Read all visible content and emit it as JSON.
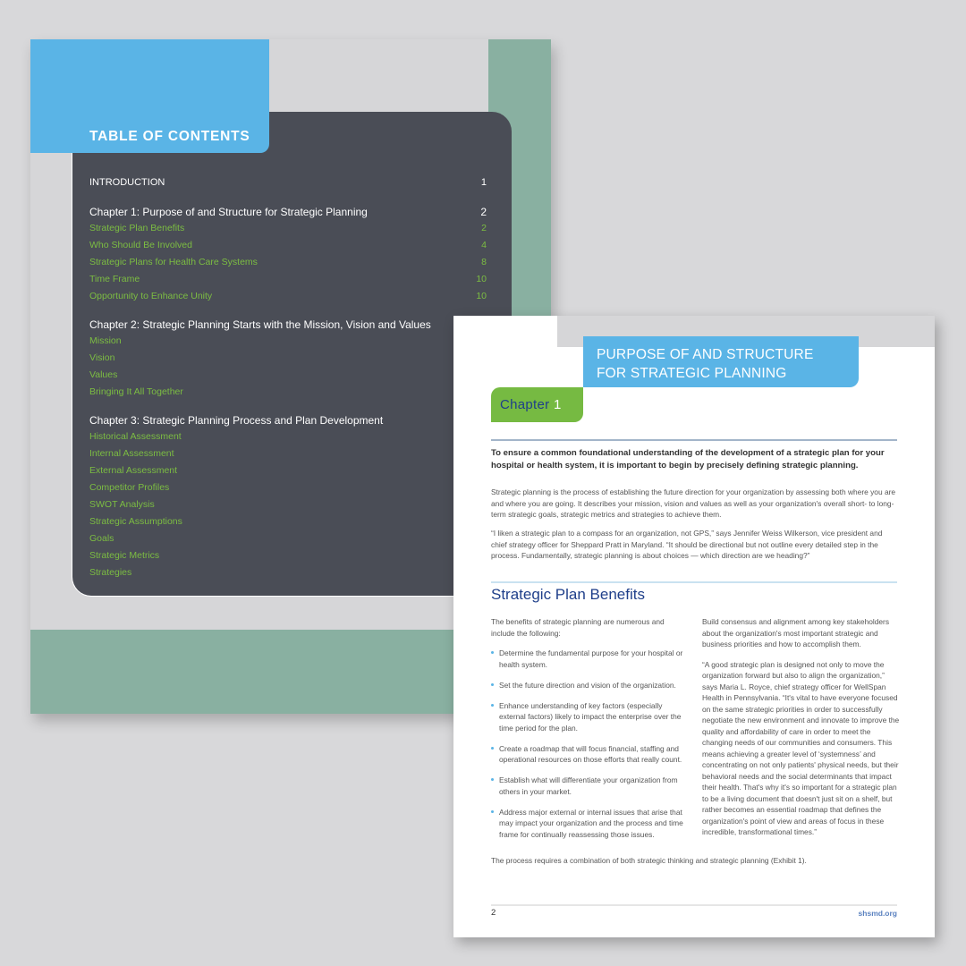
{
  "toc_page": {
    "title": "TABLE OF CONTENTS",
    "introduction": {
      "label": "INTRODUCTION",
      "page": "1"
    },
    "chapters": [
      {
        "label": "Chapter 1: Purpose of and Structure for Strategic Planning",
        "page": "2",
        "sections": [
          {
            "label": "Strategic Plan Benefits",
            "page": "2"
          },
          {
            "label": "Who Should Be Involved",
            "page": "4"
          },
          {
            "label": "Strategic Plans for Health Care Systems",
            "page": "8"
          },
          {
            "label": "Time Frame",
            "page": "10"
          },
          {
            "label": "Opportunity to Enhance Unity",
            "page": "10"
          }
        ]
      },
      {
        "label": "Chapter 2: Strategic Planning Starts with the Mission, Vision and Values",
        "page": "",
        "sections": [
          {
            "label": "Mission",
            "page": ""
          },
          {
            "label": "Vision",
            "page": ""
          },
          {
            "label": "Values",
            "page": ""
          },
          {
            "label": "Bringing It All Together",
            "page": ""
          }
        ]
      },
      {
        "label": "Chapter 3: Strategic Planning Process and Plan Development",
        "page": "",
        "sections": [
          {
            "label": "Historical Assessment",
            "page": ""
          },
          {
            "label": "Internal Assessment",
            "page": ""
          },
          {
            "label": "External Assessment",
            "page": ""
          },
          {
            "label": "Competitor Profiles",
            "page": ""
          },
          {
            "label": "SWOT Analysis",
            "page": ""
          },
          {
            "label": "Strategic Assumptions",
            "page": ""
          },
          {
            "label": "Goals",
            "page": ""
          },
          {
            "label": "Strategic Metrics",
            "page": ""
          },
          {
            "label": "Strategies",
            "page": ""
          }
        ]
      }
    ]
  },
  "chapter_page": {
    "title_line1": "PURPOSE OF AND STRUCTURE",
    "title_line2": "FOR STRATEGIC PLANNING",
    "chapter_word": "Chapter",
    "chapter_number": "1",
    "lede": "To ensure a common foundational understanding of the development of a strategic plan for your hospital or health system, it is important to begin by precisely defining strategic planning.",
    "intro_paragraphs": [
      "Strategic planning is the process of establishing the future direction for your organization by assessing both where you are and where you are going. It describes your mission, vision and values as well as your organization's overall short- to long-term strategic goals, strategic metrics and strategies to achieve them.",
      "“I liken a strategic plan to a compass for an organization, not GPS,” says Jennifer Weiss Wilkerson, vice president and chief strategy officer for Sheppard Pratt in Maryland. “It should be directional but not outline every detailed step in the process. Fundamentally, strategic planning is about choices — which direction are we heading?”"
    ],
    "section_title": "Strategic Plan Benefits",
    "benefits_intro": "The benefits of strategic planning are numerous and include the following:",
    "bullets": [
      "Determine the fundamental purpose for your hospital or health system.",
      "Set the future direction and vision of the organization.",
      "Enhance understanding of key factors (especially external factors) likely to impact the enterprise over the time period for the plan.",
      "Create a roadmap that will focus financial, staffing and operational resources on those efforts that really count.",
      "Establish what will differentiate your organization from others in your market.",
      "Address major external or internal issues that arise that may impact your organization and the process and time frame for continually reassessing those issues."
    ],
    "right_col_paragraphs": [
      "Build consensus and alignment among key stakeholders about the organization's most important strategic and business priorities and how to accomplish them.",
      "“A good strategic plan is designed not only to move the organization forward but also to align the organization,” says Maria L. Royce, chief strategy officer for WellSpan Health in Pennsylvania. “It's vital to have everyone focused on the same strategic priorities in order to successfully negotiate the new environment and innovate to improve the quality and affordability of care in order to meet the changing needs of our communities and consumers. This means achieving a greater level of ‘systemness’ and concentrating on not only patients' physical needs, but their behavioral needs and the social determinants that impact their health. That's why it's so important for a strategic plan to be a living document that doesn't just sit on a shelf, but rather becomes an essential roadmap that defines the organization's point of view and areas of focus in these incredible, transformational times.”"
    ],
    "closing": "The process requires a combination of both strategic thinking and strategic planning (Exhibit 1).",
    "footer_page_number": "2",
    "footer_url": "shsmd.org"
  },
  "colors": {
    "blue_tab": "#5ab4e6",
    "green_tab": "#76ba42",
    "toc_dark": "#4a4d56",
    "sage": "#89b0a1",
    "toc_link_green": "#7cbd42",
    "heading_navy": "#1f3f8a"
  }
}
